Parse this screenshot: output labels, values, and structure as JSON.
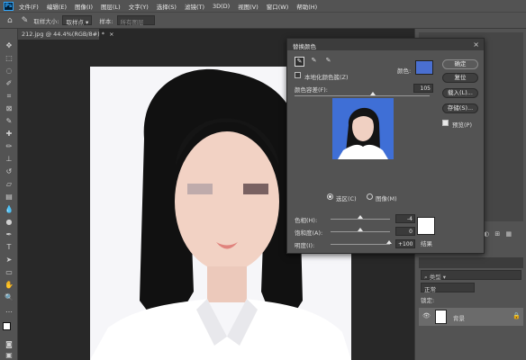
{
  "menubar": {
    "items": [
      "文件(F)",
      "编辑(E)",
      "图像(I)",
      "图层(L)",
      "文字(Y)",
      "选择(S)",
      "滤镜(T)",
      "3D(D)",
      "视图(V)",
      "窗口(W)",
      "帮助(H)"
    ]
  },
  "optionsbar": {
    "sample_size_label": "取样大小:",
    "sample_size_value": "取样点",
    "sample_label": "样本:",
    "sample_value": "所有图层"
  },
  "document": {
    "tab_title": "212.jpg @ 44.4%(RGB/8#) *"
  },
  "dialog": {
    "title": "替换颜色",
    "localized_clusters_label": "本地化颜色簇(Z)",
    "color_label": "颜色:",
    "fuzziness_label": "颜色容差(F):",
    "fuzziness_value": "105",
    "selection_label": "选区(C)",
    "image_label": "图像(M)",
    "hue_label": "色相(H):",
    "hue_value": "-4",
    "saturation_label": "饱和度(A):",
    "saturation_value": "0",
    "lightness_label": "明度(I):",
    "lightness_value": "+100",
    "result_label": "结果",
    "ok_button": "确定",
    "reset_button": "复位",
    "load_button": "载入(L)...",
    "save_button": "存储(S)...",
    "preview_label": "预览(P)",
    "swatch_color": "#4a6fd0",
    "result_color": "#ffffff"
  },
  "layers": {
    "search_placeholder": "类型",
    "blend_mode": "正常",
    "lock_label": "锁定:",
    "layer_name": "背景"
  }
}
